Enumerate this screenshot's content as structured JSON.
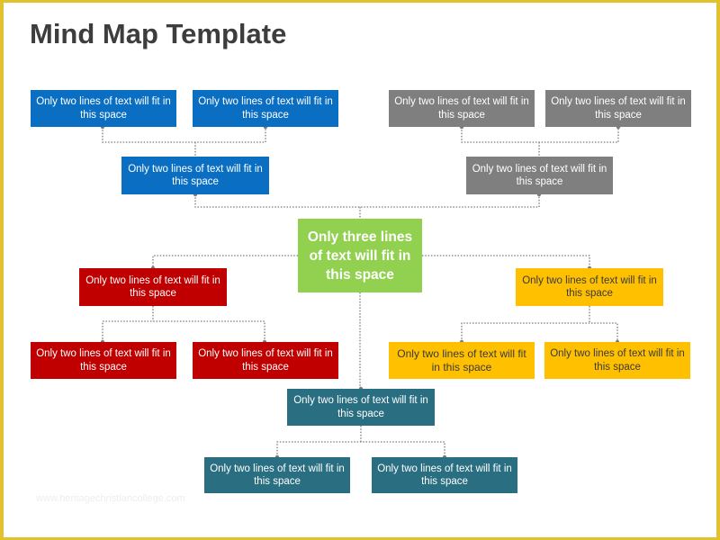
{
  "title": "Mind Map Template",
  "watermark": "www.heritagechristiancollege.com",
  "colors": {
    "frame": "#e0c22e",
    "blue": "#0a6fc2",
    "gray": "#7f7f7f",
    "green": "#92d050",
    "red": "#c00000",
    "yellow": "#ffc000",
    "teal": "#296e81",
    "connector": "#7a7a7a"
  },
  "center": {
    "text": "Only three lines of text will fit in this space"
  },
  "branches": {
    "blue": {
      "main": "Only two lines of text  will fit in this space",
      "children": [
        "Only two lines of text  will fit in this space",
        "Only two lines of text  will fit in this space"
      ]
    },
    "gray": {
      "main": "Only two lines of text  will fit in this space",
      "children": [
        "Only two lines of text  will fit in this space",
        "Only two lines of text  will fit in this space"
      ]
    },
    "red": {
      "main": "Only two lines of text  will fit in this space",
      "children": [
        "Only two lines of text  will fit in this space",
        "Only two lines of text  will fit in this space"
      ]
    },
    "yellow": {
      "main": "Only two lines of text will fit in this space",
      "children": [
        "Only two lines of text will fit in this space",
        "Only two lines of text  will fit in this space"
      ]
    },
    "teal": {
      "main": "Only two lines of text  will fit in this space",
      "children": [
        "Only two lines of text  will fit in this space",
        "Only two lines of text  will fit in this space"
      ]
    }
  }
}
